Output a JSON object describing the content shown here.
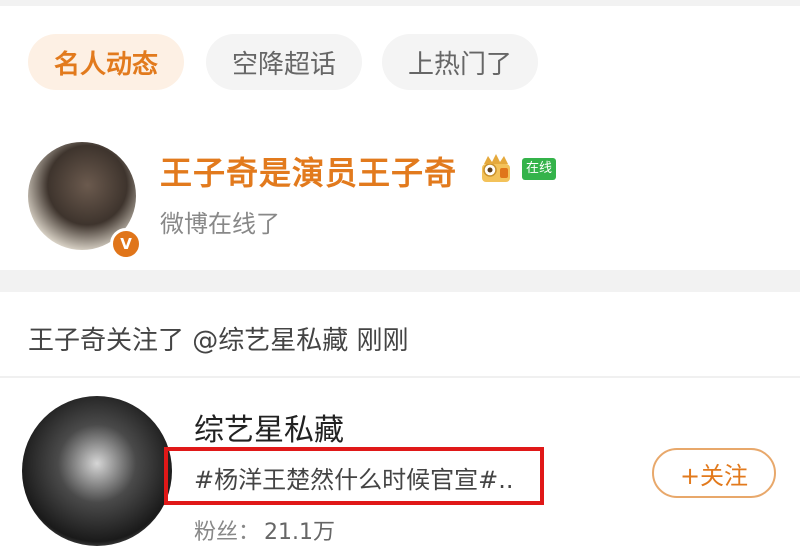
{
  "tabs": [
    {
      "label": "名人动态",
      "active": true
    },
    {
      "label": "空降超话",
      "active": false
    },
    {
      "label": "上热门了",
      "active": false
    }
  ],
  "featured_user": {
    "name": "王子奇是演员王子奇",
    "status_badge": "在线",
    "subtitle": "微博在线了",
    "verified_mark": "V"
  },
  "activity": {
    "text": "王子奇关注了 @综艺星私藏 刚刚"
  },
  "followed_account": {
    "name": "综艺星私藏",
    "description": "#杨洋王楚然什么时候官宣#..",
    "fans_label": "粉丝：",
    "fans_count": "21.1万",
    "follow_button": "+关注"
  },
  "colors": {
    "accent": "#e27a1d",
    "highlight_box": "#e01818",
    "online_green": "#34b34a"
  }
}
